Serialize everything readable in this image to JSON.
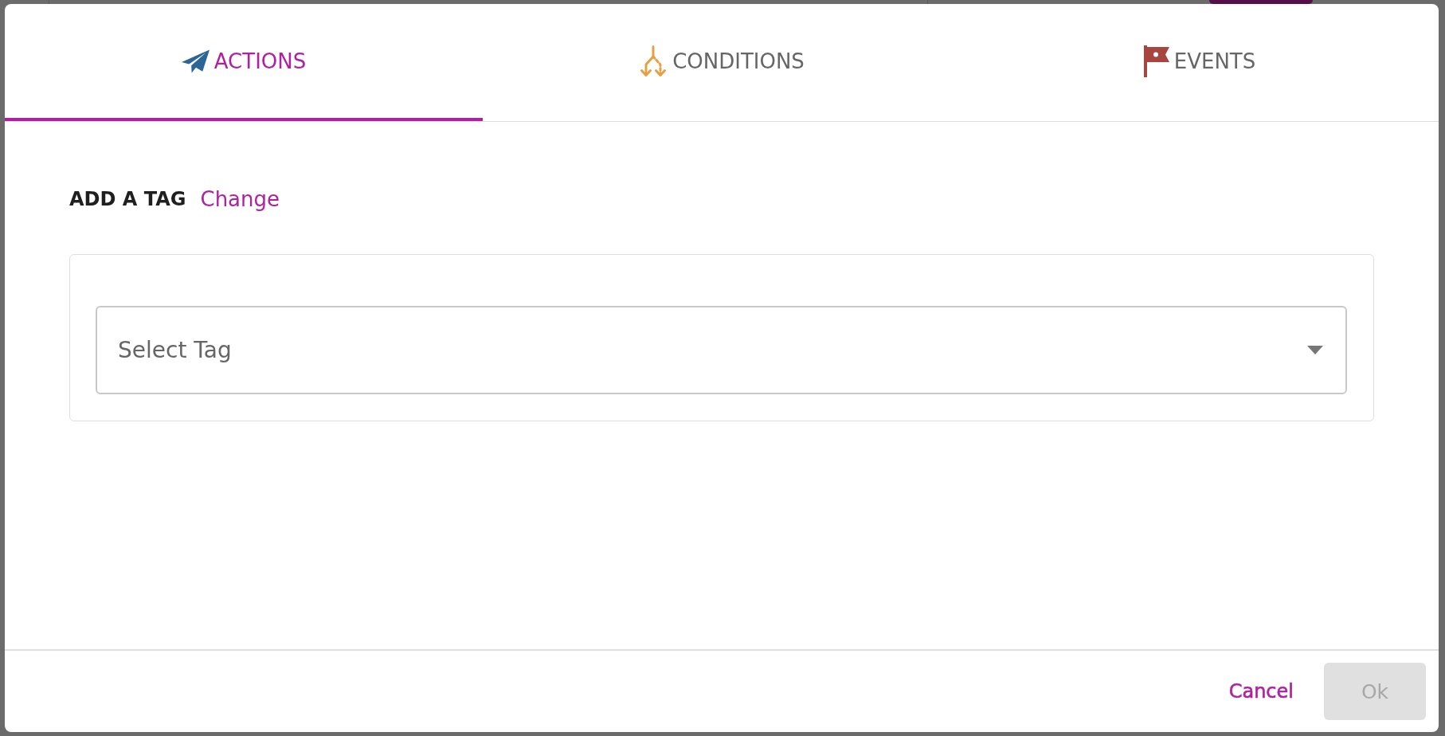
{
  "tabs": [
    {
      "label": "ACTIONS",
      "selected": true
    },
    {
      "label": "CONDITIONS",
      "selected": false
    },
    {
      "label": "EVENTS",
      "selected": false
    }
  ],
  "section": {
    "title": "ADD A TAG",
    "link": "Change"
  },
  "tag_select": {
    "placeholder": "Select Tag"
  },
  "footer": {
    "buttons": [
      {
        "label": "Cancel",
        "kind": "link",
        "disabled": false
      },
      {
        "label": "Ok",
        "kind": "filled",
        "disabled": true
      }
    ]
  }
}
